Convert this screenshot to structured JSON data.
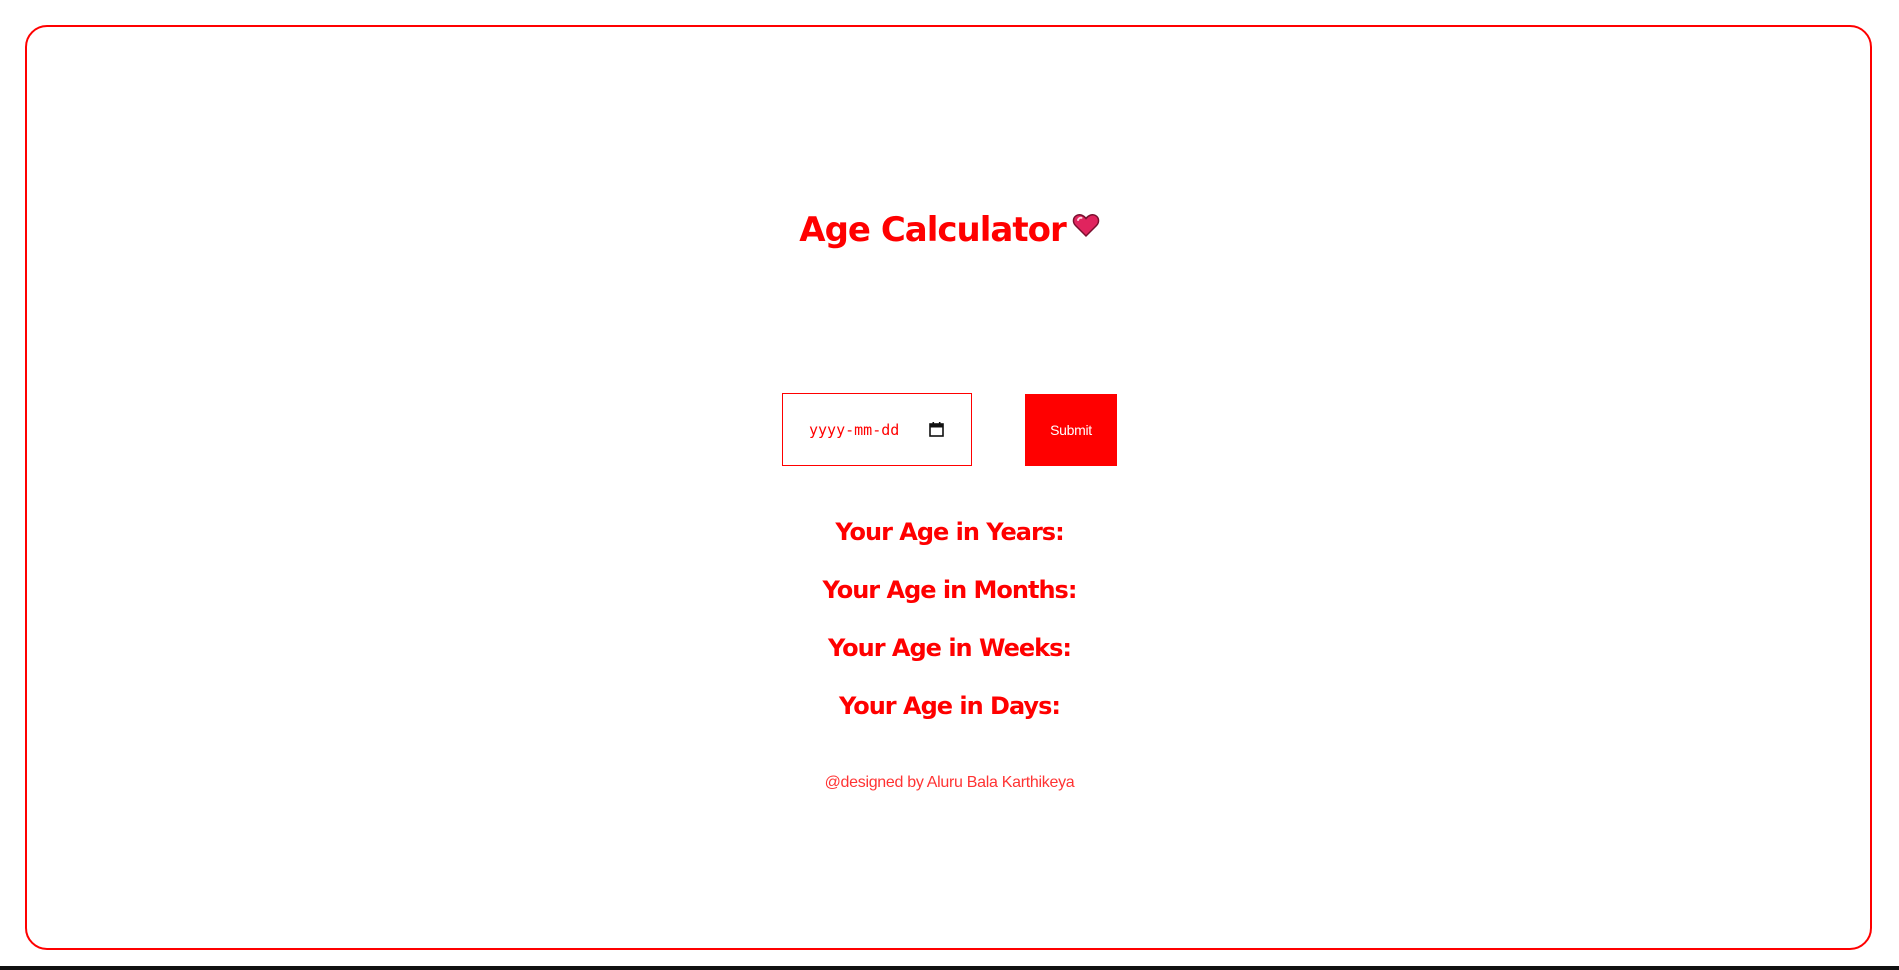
{
  "page": {
    "title": "Age Calculator",
    "title_icon": "heart-icon",
    "accent_color": "#ff0000"
  },
  "form": {
    "date_placeholder": "yyyy-mm-dd",
    "date_icon": "calendar-icon",
    "submit_label": "Submit"
  },
  "results": {
    "years_label": "Your Age in Years:",
    "months_label": "Your Age in Months:",
    "weeks_label": "Your Age in Weeks:",
    "days_label": "Your Age in Days:"
  },
  "footer": {
    "credit": "@designed by Aluru Bala Karthikeya"
  }
}
